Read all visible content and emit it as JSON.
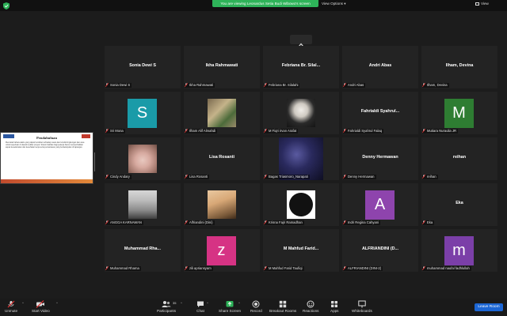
{
  "top": {
    "banner": "You are viewing Leonardus Setia Budi Wibowo's screen",
    "view_options": "View Options ▾",
    "view": "View",
    "colors": {
      "banner": "#2eb359",
      "shield": "#2eb359"
    }
  },
  "share": {
    "title": "Pendahuluan",
    "body": "Mencatat bahwa waktu yang dapat bertahan terhadap cuaca dan kondisi lingkungan dan area untuk keperluan di daerah sekitar proyek. Sistem fasilitas bagi pekerja harus memperhatikan aspek keselamatan dan kesehatan kerja serta pemantauan yang berkelanjutan di lapangan."
  },
  "tiles": [
    {
      "name": "Sonia Dewi S",
      "label": "Sonia Dewi S",
      "kind": "name"
    },
    {
      "name": "Ikha Rahmawati",
      "label": "Ikha Rahmawati",
      "kind": "name"
    },
    {
      "name": "Febriana Br. Silal...",
      "label": "Febriana Br. Silalahi",
      "kind": "name"
    },
    {
      "name": "Andri Abas",
      "label": "Andri Abas",
      "kind": "name"
    },
    {
      "name": "Ilham, Devina",
      "label": "Ilham, Devina",
      "kind": "name"
    },
    {
      "letter": "S",
      "label": "Sri Mona",
      "kind": "avatar",
      "color": "#1a9ba8"
    },
    {
      "label": "Ilham Alif Almahdi",
      "kind": "photo",
      "photo": "photo-plants"
    },
    {
      "label": "M Fiqri irvan Arafat",
      "kind": "photo",
      "photo": "photo-person-dark"
    },
    {
      "name": "Fahrialdi  Syahrul...",
      "label": "Fahrialdi Syahrul Falaq",
      "kind": "name"
    },
    {
      "letter": "M",
      "label": "Mutiara Nuraulia JR",
      "kind": "avatar",
      "color": "#2e7d32"
    },
    {
      "label": "Cindy Andary",
      "kind": "photo",
      "photo": "photo-face-blur"
    },
    {
      "name": "Lisa Rosanti",
      "label": "Lisa Rosanti",
      "kind": "name"
    },
    {
      "label": "Bagas Triasmoro_Narapati",
      "kind": "photo",
      "photo": "photo-space"
    },
    {
      "name": "Denny Hermawan",
      "label": "Denny Hermawan",
      "kind": "name"
    },
    {
      "name": "reihan",
      "label": "reihan",
      "kind": "name"
    },
    {
      "label": "ANGGA KARNAWAN",
      "kind": "photo",
      "photo": "photo-mask-man"
    },
    {
      "label": "Alfriandini (Dini)",
      "kind": "photo",
      "photo": "photo-woman"
    },
    {
      "label": "Krisna Fajri Ramadhan",
      "kind": "photo",
      "photo": "photo-civil-engineer",
      "logo_text": "CIVIL ENGINEER"
    },
    {
      "letter": "A",
      "label": "Indri Regina Cahyani",
      "kind": "avatar",
      "color": "#8e44ad"
    },
    {
      "name": "Eka",
      "label": "Eka",
      "kind": "name"
    },
    {
      "name": "Muhammad  Rha...",
      "label": "Muhammad Rhama",
      "kind": "name"
    },
    {
      "letter": "Z",
      "label": "zili apriansyam",
      "kind": "avatar",
      "color": "#d63384",
      "lower": "z"
    },
    {
      "name": "M  Mahfud  Farid...",
      "label": "M Mahfud Farid Taufiqi",
      "kind": "name"
    },
    {
      "name": "ALFRIANDINI  (D...",
      "label": "ALFRIANDINI (DINI-2)",
      "kind": "name"
    },
    {
      "letter": "m",
      "label": "muhammad naufal fadhlullah",
      "kind": "avatar",
      "color": "#7b3fa8"
    }
  ],
  "toolbar": {
    "unmute": "Unmute",
    "start_video": "Start Video",
    "participants": "Participants",
    "participants_count": "35",
    "chat": "Chat",
    "share_screen": "Share Screen",
    "record": "Record",
    "breakout": "Breakout Rooms",
    "reactions": "Reactions",
    "apps": "Apps",
    "whiteboards": "Whiteboards",
    "leave": "Leave Room",
    "colors": {
      "share": "#2eb359",
      "leave": "#1c66d4",
      "muted": "#e03131"
    }
  }
}
